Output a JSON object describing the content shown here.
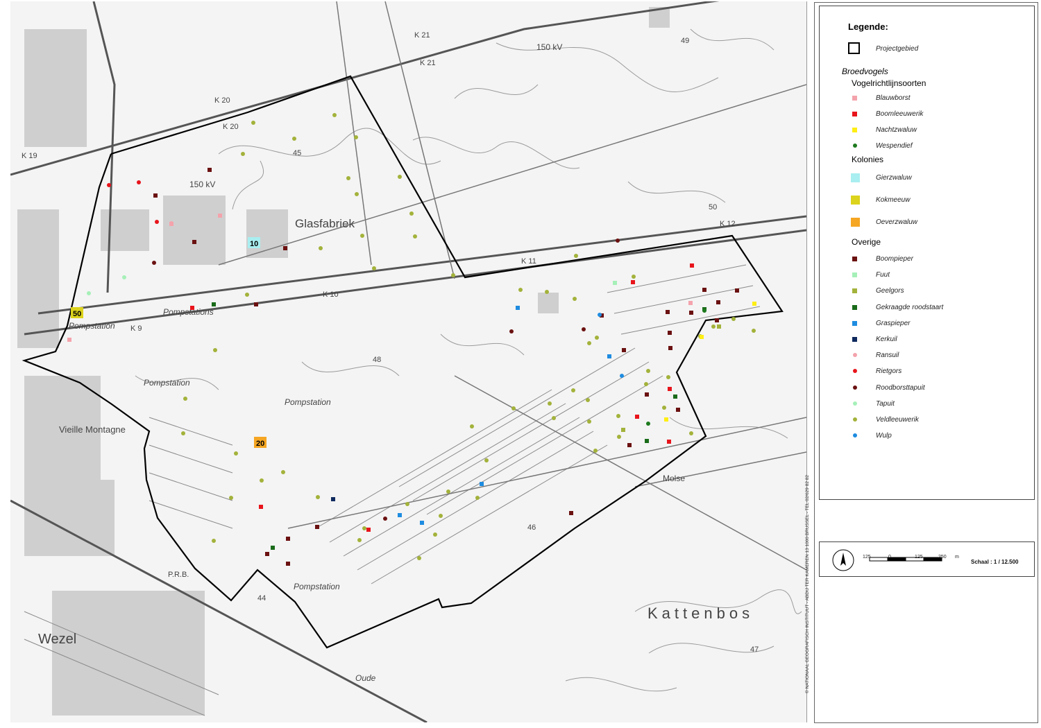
{
  "legend": {
    "title": "Legende:",
    "project_area": "Projectgebied",
    "section_breeding": "Broedvogels",
    "group_directive": "Vogelrichtlijnsoorten",
    "group_colonies": "Kolonies",
    "group_other": "Overige",
    "directive_species": [
      {
        "label": "Blauwborst",
        "color": "#f4a3ac",
        "shape": "square"
      },
      {
        "label": "Boomleeuwerik",
        "color": "#e8141b",
        "shape": "square"
      },
      {
        "label": "Nachtzwaluw",
        "color": "#ffee14",
        "shape": "square"
      },
      {
        "label": "Wespendief",
        "color": "#1e7a1e",
        "shape": "dot"
      }
    ],
    "colony_species": [
      {
        "label": "Gierzwaluw",
        "color": "#a9eef0",
        "shape": "big"
      },
      {
        "label": "Kokmeeuw",
        "color": "#dcd31c",
        "shape": "big"
      },
      {
        "label": "Oeverzwaluw",
        "color": "#f5a623",
        "shape": "big"
      }
    ],
    "other_species": [
      {
        "label": "Boompieper",
        "color": "#6b1111",
        "shape": "square"
      },
      {
        "label": "Fuut",
        "color": "#a6f0b8",
        "shape": "square"
      },
      {
        "label": "Geelgors",
        "color": "#a3b23a",
        "shape": "square"
      },
      {
        "label": "Gekraagde roodstaart",
        "color": "#1a6b1a",
        "shape": "square"
      },
      {
        "label": "Graspieper",
        "color": "#1e8ce0",
        "shape": "square"
      },
      {
        "label": "Kerkuil",
        "color": "#0f2a5e",
        "shape": "square"
      },
      {
        "label": "Ransuil",
        "color": "#f4a3ac",
        "shape": "dot"
      },
      {
        "label": "Rietgors",
        "color": "#e8141b",
        "shape": "dot"
      },
      {
        "label": "Roodborsttapuit",
        "color": "#6b1111",
        "shape": "dot"
      },
      {
        "label": "Tapuit",
        "color": "#a6f0b8",
        "shape": "dot"
      },
      {
        "label": "Veldleeuwerik",
        "color": "#a3b23a",
        "shape": "dot"
      },
      {
        "label": "Wulp",
        "color": "#1e8ce0",
        "shape": "dot"
      }
    ]
  },
  "scale": {
    "ticks": [
      "125",
      "0",
      "125",
      "250",
      "m"
    ],
    "label": "Schaal : 1 / 12.500"
  },
  "credit": "© NATIONAAL GEOGRAFISCH INSTITUUT - ABDIJ TER KAMEREN 13 1000 BRUSSEL - TEL 02/629 82 82",
  "map_labels": {
    "glasfabriek": "Glasfabriek",
    "pompstation": "Pompstation",
    "pompstations": "Pompstations",
    "vieille_montagne": "Vieille Montagne",
    "kattenbos": "Kattenbos",
    "wezel": "Wezel",
    "molse": "Molse",
    "oude": "Oude",
    "kv150a": "150 kV",
    "kv150b": "150 kV",
    "k21": "K 21",
    "k21b": "K 21",
    "k20": "K 20",
    "k20b": "K 20",
    "k19": "K 19",
    "k9": "K 9",
    "k10": "K 10",
    "k11": "K 11",
    "k12": "K 12",
    "c45": "45",
    "c50": "50",
    "c48": "48",
    "c46": "46",
    "c49": "49",
    "c47": "47",
    "c44": "44",
    "prb": "P.R.B."
  },
  "colony_counts": {
    "gierzwaluw": "10",
    "kokmeeuw": "50",
    "oeverzwaluw": "20"
  }
}
